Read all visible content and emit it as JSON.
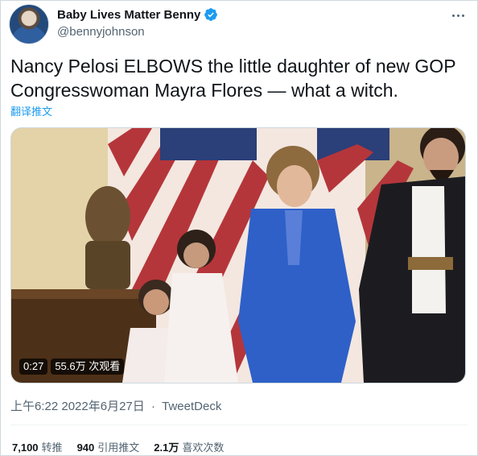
{
  "author": {
    "display_name": "Baby Lives Matter Benny",
    "handle": "@bennyjohnson",
    "verified": true
  },
  "tweet": {
    "text": "Nancy Pelosi ELBOWS the little daughter of new GOP Congresswoman Mayra Flores — what a witch.",
    "translate_label": "翻译推文"
  },
  "media": {
    "duration": "0:27",
    "views": "55.6万 次观看"
  },
  "meta": {
    "time": "上午6:22",
    "date": "2022年6月27日",
    "source": "TweetDeck",
    "separator": "·"
  },
  "stats": {
    "retweets": {
      "count": "7,100",
      "label": "转推"
    },
    "quotes": {
      "count": "940",
      "label": "引用推文"
    },
    "likes": {
      "count": "2.1万",
      "label": "喜欢次数"
    }
  },
  "colors": {
    "accent": "#1d9bf0",
    "secondary_text": "#536471",
    "border": "#cfd9de"
  }
}
